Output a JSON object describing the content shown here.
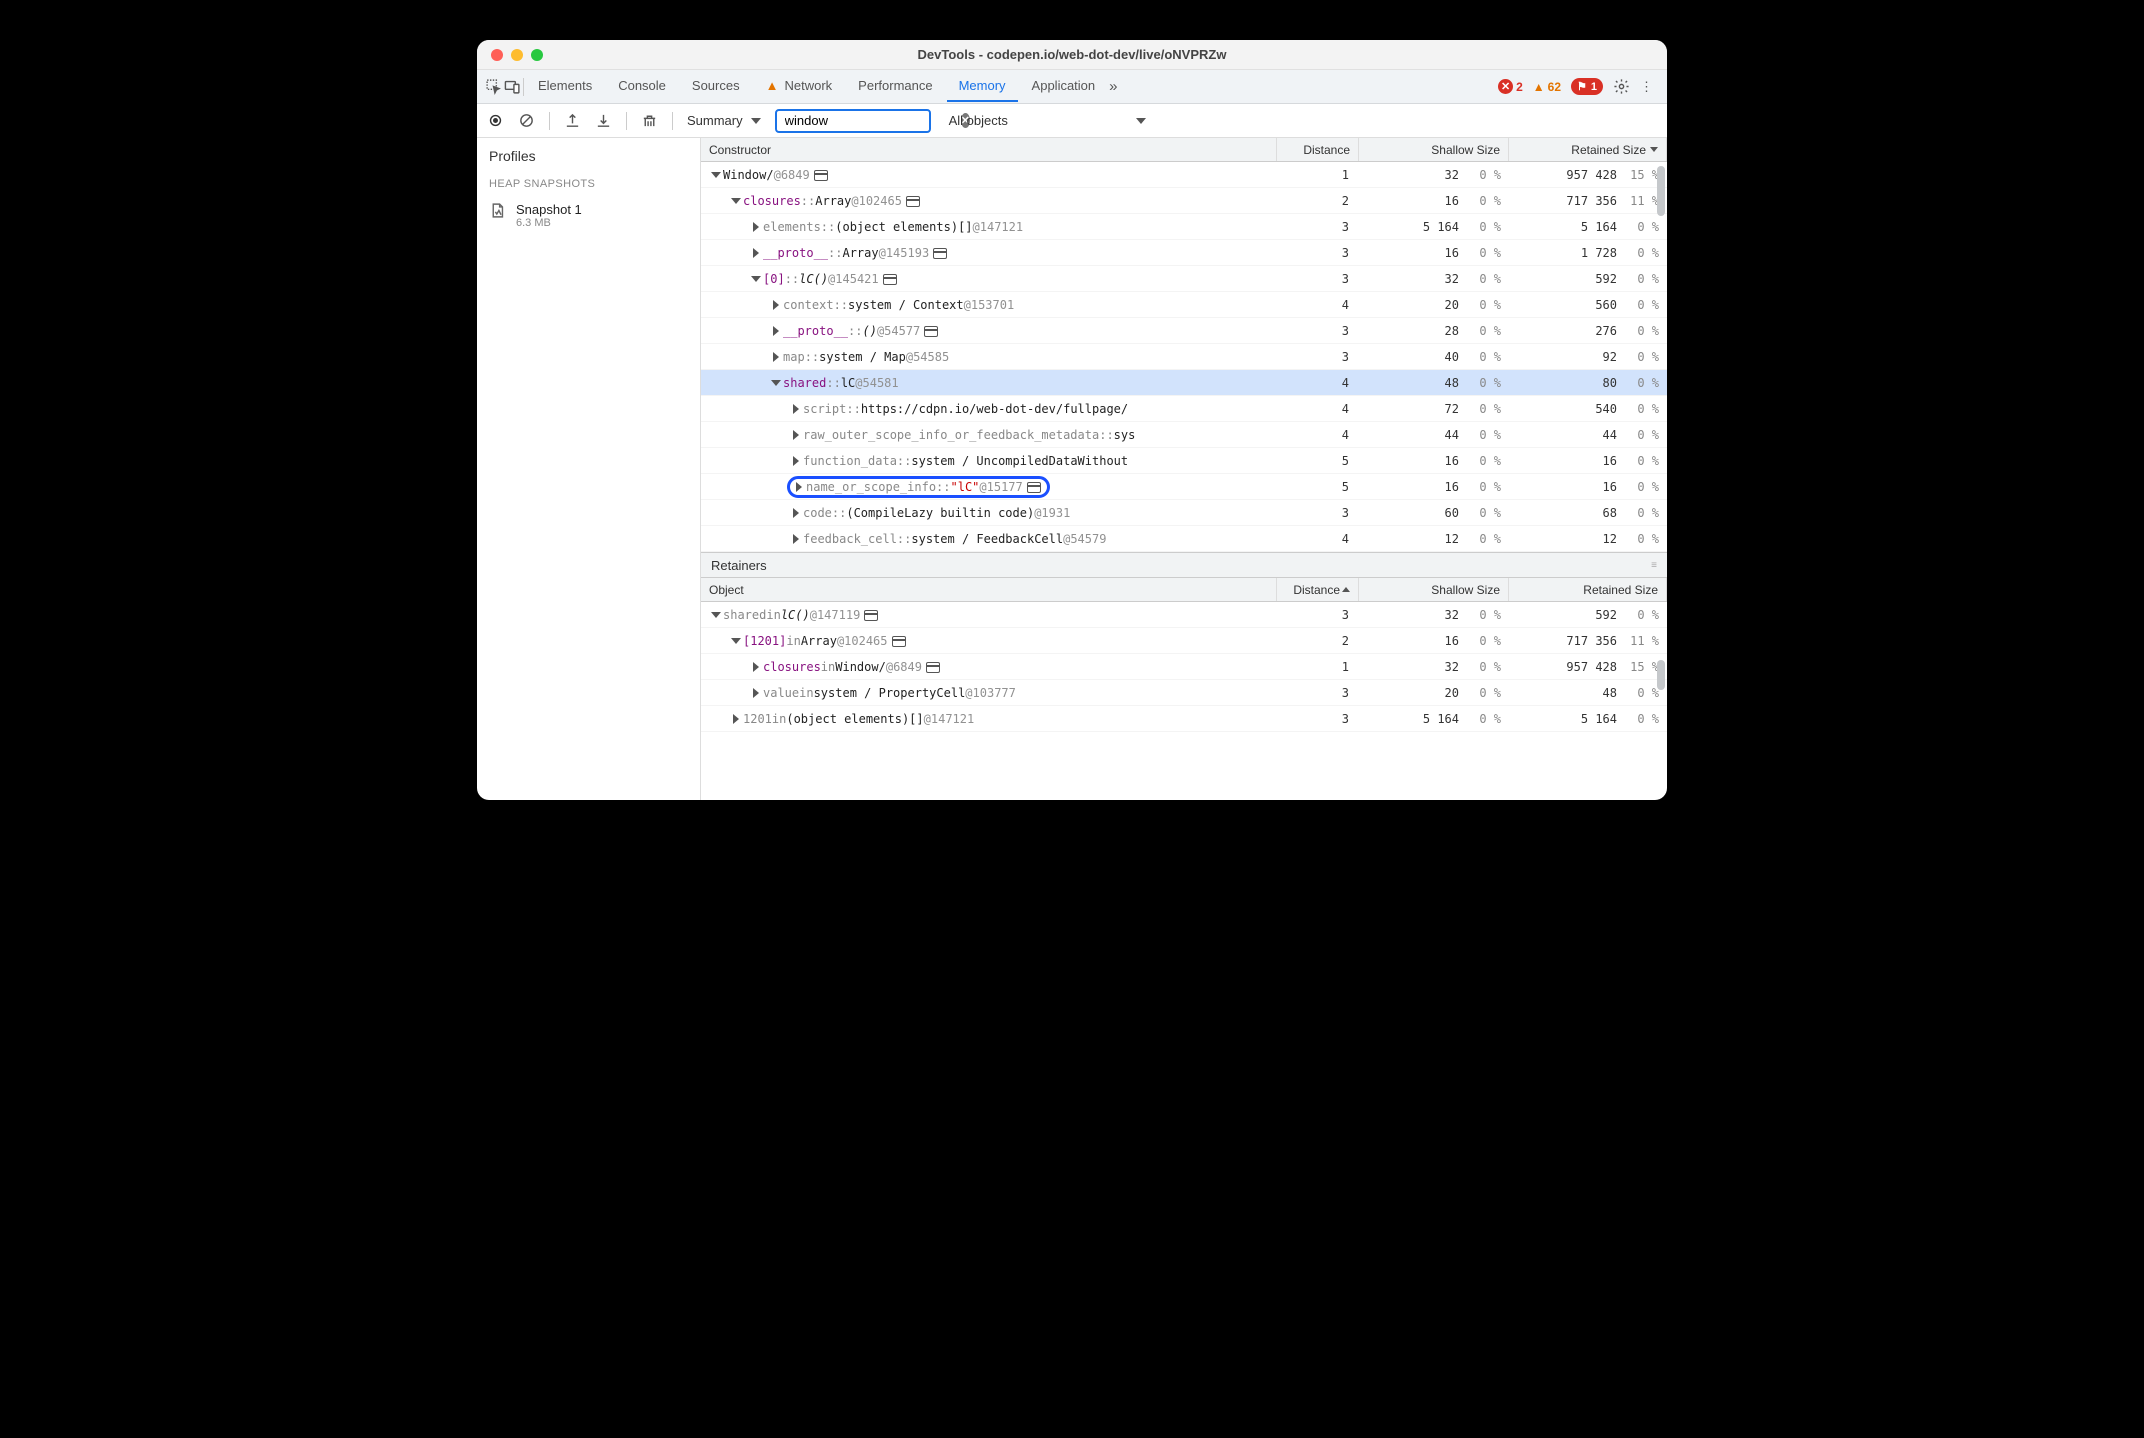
{
  "window_title": "DevTools - codepen.io/web-dot-dev/live/oNVPRZw",
  "tabs": [
    "Elements",
    "Console",
    "Sources",
    "Network",
    "Performance",
    "Memory",
    "Application"
  ],
  "active_tab": "Memory",
  "network_has_warning": true,
  "overflow_glyph": "»",
  "error_count": "2",
  "warning_count": "62",
  "info_count": "1",
  "toolbar": {
    "view_mode": "Summary",
    "filter_value": "window",
    "scope_label": "All objects"
  },
  "sidebar": {
    "title": "Profiles",
    "section": "HEAP SNAPSHOTS",
    "snapshot": {
      "name": "Snapshot 1",
      "size": "6.3 MB"
    }
  },
  "headers": {
    "constructor": "Constructor",
    "distance": "Distance",
    "shallow": "Shallow Size",
    "retained": "Retained Size",
    "object": "Object"
  },
  "rows": [
    {
      "indent": 0,
      "disc": "open",
      "segments": [
        {
          "t": "Window",
          "c": "black"
        },
        {
          "t": " / ",
          "c": "black"
        },
        {
          "t": "   @6849",
          "c": "id"
        }
      ],
      "win": true,
      "dist": "1",
      "sh": "32",
      "shp": "0 %",
      "ret": "957 428",
      "retp": "15 %"
    },
    {
      "indent": 1,
      "disc": "open",
      "segments": [
        {
          "t": "closures",
          "c": "purple"
        },
        {
          "t": " :: ",
          "c": "gray"
        },
        {
          "t": "Array ",
          "c": "black"
        },
        {
          "t": "@102465",
          "c": "id"
        }
      ],
      "win": true,
      "dist": "2",
      "sh": "16",
      "shp": "0 %",
      "ret": "717 356",
      "retp": "11 %"
    },
    {
      "indent": 2,
      "disc": "closed",
      "segments": [
        {
          "t": "elements",
          "c": "gray"
        },
        {
          "t": " :: ",
          "c": "gray"
        },
        {
          "t": "(object elements)[] ",
          "c": "black"
        },
        {
          "t": "@147121",
          "c": "id"
        }
      ],
      "win": false,
      "dist": "3",
      "sh": "5 164",
      "shp": "0 %",
      "ret": "5 164",
      "retp": "0 %"
    },
    {
      "indent": 2,
      "disc": "closed",
      "segments": [
        {
          "t": "__proto__",
          "c": "purple"
        },
        {
          "t": " :: ",
          "c": "gray"
        },
        {
          "t": "Array ",
          "c": "black"
        },
        {
          "t": "@145193",
          "c": "id"
        }
      ],
      "win": true,
      "dist": "3",
      "sh": "16",
      "shp": "0 %",
      "ret": "1 728",
      "retp": "0 %"
    },
    {
      "indent": 2,
      "disc": "open",
      "segments": [
        {
          "t": "[0]",
          "c": "purple"
        },
        {
          "t": " :: ",
          "c": "gray"
        },
        {
          "t": "lC() ",
          "c": "italic-black"
        },
        {
          "t": "@145421",
          "c": "id"
        }
      ],
      "win": true,
      "dist": "3",
      "sh": "32",
      "shp": "0 %",
      "ret": "592",
      "retp": "0 %"
    },
    {
      "indent": 3,
      "disc": "closed",
      "segments": [
        {
          "t": "context",
          "c": "gray"
        },
        {
          "t": " :: ",
          "c": "gray"
        },
        {
          "t": "system / Context ",
          "c": "black"
        },
        {
          "t": "@153701",
          "c": "id"
        }
      ],
      "win": false,
      "dist": "4",
      "sh": "20",
      "shp": "0 %",
      "ret": "560",
      "retp": "0 %"
    },
    {
      "indent": 3,
      "disc": "closed",
      "segments": [
        {
          "t": "__proto__",
          "c": "purple"
        },
        {
          "t": " :: ",
          "c": "gray"
        },
        {
          "t": "() ",
          "c": "italic-black"
        },
        {
          "t": "@54577",
          "c": "id"
        }
      ],
      "win": true,
      "dist": "3",
      "sh": "28",
      "shp": "0 %",
      "ret": "276",
      "retp": "0 %"
    },
    {
      "indent": 3,
      "disc": "closed",
      "segments": [
        {
          "t": "map",
          "c": "gray"
        },
        {
          "t": " :: ",
          "c": "gray"
        },
        {
          "t": "system / Map ",
          "c": "black"
        },
        {
          "t": "@54585",
          "c": "id"
        }
      ],
      "win": false,
      "dist": "3",
      "sh": "40",
      "shp": "0 %",
      "ret": "92",
      "retp": "0 %"
    },
    {
      "indent": 3,
      "disc": "open",
      "segments": [
        {
          "t": "shared",
          "c": "purple"
        },
        {
          "t": " :: ",
          "c": "gray"
        },
        {
          "t": "lC ",
          "c": "black"
        },
        {
          "t": "@54581",
          "c": "id"
        }
      ],
      "win": false,
      "dist": "4",
      "sh": "48",
      "shp": "0 %",
      "ret": "80",
      "retp": "0 %",
      "sel": true
    },
    {
      "indent": 4,
      "disc": "closed",
      "segments": [
        {
          "t": "script",
          "c": "gray"
        },
        {
          "t": " :: ",
          "c": "gray"
        },
        {
          "t": "https://cdpn.io/web-dot-dev/fullpage/",
          "c": "black"
        }
      ],
      "win": false,
      "dist": "4",
      "sh": "72",
      "shp": "0 %",
      "ret": "540",
      "retp": "0 %"
    },
    {
      "indent": 4,
      "disc": "closed",
      "segments": [
        {
          "t": "raw_outer_scope_info_or_feedback_metadata",
          "c": "gray"
        },
        {
          "t": " :: ",
          "c": "gray"
        },
        {
          "t": "sys",
          "c": "black"
        }
      ],
      "win": false,
      "dist": "4",
      "sh": "44",
      "shp": "0 %",
      "ret": "44",
      "retp": "0 %"
    },
    {
      "indent": 4,
      "disc": "closed",
      "segments": [
        {
          "t": "function_data",
          "c": "gray"
        },
        {
          "t": " :: ",
          "c": "gray"
        },
        {
          "t": "system / UncompiledDataWithout",
          "c": "black"
        }
      ],
      "win": false,
      "dist": "5",
      "sh": "16",
      "shp": "0 %",
      "ret": "16",
      "retp": "0 %"
    },
    {
      "indent": 4,
      "disc": "closed",
      "ring": true,
      "segments": [
        {
          "t": "name_or_scope_info",
          "c": "gray"
        },
        {
          "t": " :: ",
          "c": "gray"
        },
        {
          "t": "\"lC\" ",
          "c": "red"
        },
        {
          "t": "@15177",
          "c": "id"
        }
      ],
      "win": true,
      "dist": "5",
      "sh": "16",
      "shp": "0 %",
      "ret": "16",
      "retp": "0 %"
    },
    {
      "indent": 4,
      "disc": "closed",
      "segments": [
        {
          "t": "code",
          "c": "gray"
        },
        {
          "t": " :: ",
          "c": "gray"
        },
        {
          "t": "(CompileLazy builtin code) ",
          "c": "black"
        },
        {
          "t": "@1931",
          "c": "id"
        }
      ],
      "win": false,
      "dist": "3",
      "sh": "60",
      "shp": "0 %",
      "ret": "68",
      "retp": "0 %"
    },
    {
      "indent": 4,
      "disc": "closed",
      "segments": [
        {
          "t": "feedback_cell",
          "c": "gray"
        },
        {
          "t": " :: ",
          "c": "gray"
        },
        {
          "t": "system / FeedbackCell ",
          "c": "black"
        },
        {
          "t": "@54579",
          "c": "id"
        }
      ],
      "win": false,
      "dist": "4",
      "sh": "12",
      "shp": "0 %",
      "ret": "12",
      "retp": "0 %"
    }
  ],
  "retainers_title": "Retainers",
  "retainer_rows": [
    {
      "indent": 0,
      "disc": "open",
      "segments": [
        {
          "t": "shared",
          "c": "gray"
        },
        {
          "t": " in ",
          "c": "gray"
        },
        {
          "t": "lC() ",
          "c": "italic-black"
        },
        {
          "t": "@147119",
          "c": "id"
        }
      ],
      "win": true,
      "dist": "3",
      "sh": "32",
      "shp": "0 %",
      "ret": "592",
      "retp": "0 %"
    },
    {
      "indent": 1,
      "disc": "open",
      "segments": [
        {
          "t": "[1201]",
          "c": "purple"
        },
        {
          "t": " in ",
          "c": "gray"
        },
        {
          "t": "Array ",
          "c": "black"
        },
        {
          "t": "@102465",
          "c": "id"
        }
      ],
      "win": true,
      "dist": "2",
      "sh": "16",
      "shp": "0 %",
      "ret": "717 356",
      "retp": "11 %"
    },
    {
      "indent": 2,
      "disc": "closed",
      "segments": [
        {
          "t": "closures",
          "c": "purple"
        },
        {
          "t": " in ",
          "c": "gray"
        },
        {
          "t": "Window",
          "c": "black"
        },
        {
          "t": " / ",
          "c": "black"
        },
        {
          "t": "  @6849",
          "c": "id"
        }
      ],
      "win": true,
      "dist": "1",
      "sh": "32",
      "shp": "0 %",
      "ret": "957 428",
      "retp": "15 %"
    },
    {
      "indent": 2,
      "disc": "closed",
      "segments": [
        {
          "t": "value",
          "c": "gray"
        },
        {
          "t": " in ",
          "c": "gray"
        },
        {
          "t": "system / PropertyCell ",
          "c": "black"
        },
        {
          "t": "@103777",
          "c": "id"
        }
      ],
      "win": false,
      "dist": "3",
      "sh": "20",
      "shp": "0 %",
      "ret": "48",
      "retp": "0 %"
    },
    {
      "indent": 1,
      "disc": "closed",
      "segments": [
        {
          "t": "1201",
          "c": "gray"
        },
        {
          "t": " in ",
          "c": "gray"
        },
        {
          "t": "(object elements)[] ",
          "c": "black"
        },
        {
          "t": "@147121",
          "c": "id"
        }
      ],
      "win": false,
      "dist": "3",
      "sh": "5 164",
      "shp": "0 %",
      "ret": "5 164",
      "retp": "0 %"
    }
  ]
}
